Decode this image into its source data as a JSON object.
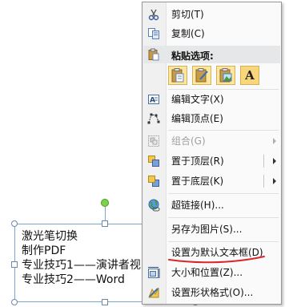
{
  "textbox": {
    "lines": [
      "激光笔切换",
      "制作PDF",
      "专业技巧1——演讲者视",
      "专业技巧2——Word"
    ]
  },
  "menu": {
    "cut": "剪切(T)",
    "copy": "复制(C)",
    "paste_options_header": "粘贴选项:",
    "paste_text_only": "A",
    "edit_text": "编辑文字(X)",
    "edit_points": "编辑顶点(E)",
    "group": "组合(G)",
    "bring_to_front": "置于顶层(R)",
    "send_to_back": "置于底层(K)",
    "hyperlink": "超链接(H)...",
    "save_as_picture": "另存为图片(S)...",
    "set_default_textbox": "设置为默认文本框(D)",
    "size_position": "大小和位置(Z)...",
    "format_shape": "设置形状格式(O)..."
  },
  "colors": {
    "annotation_underline": "#d9262a",
    "menu_border": "#979797",
    "textbox_border": "#7aa7d6"
  }
}
